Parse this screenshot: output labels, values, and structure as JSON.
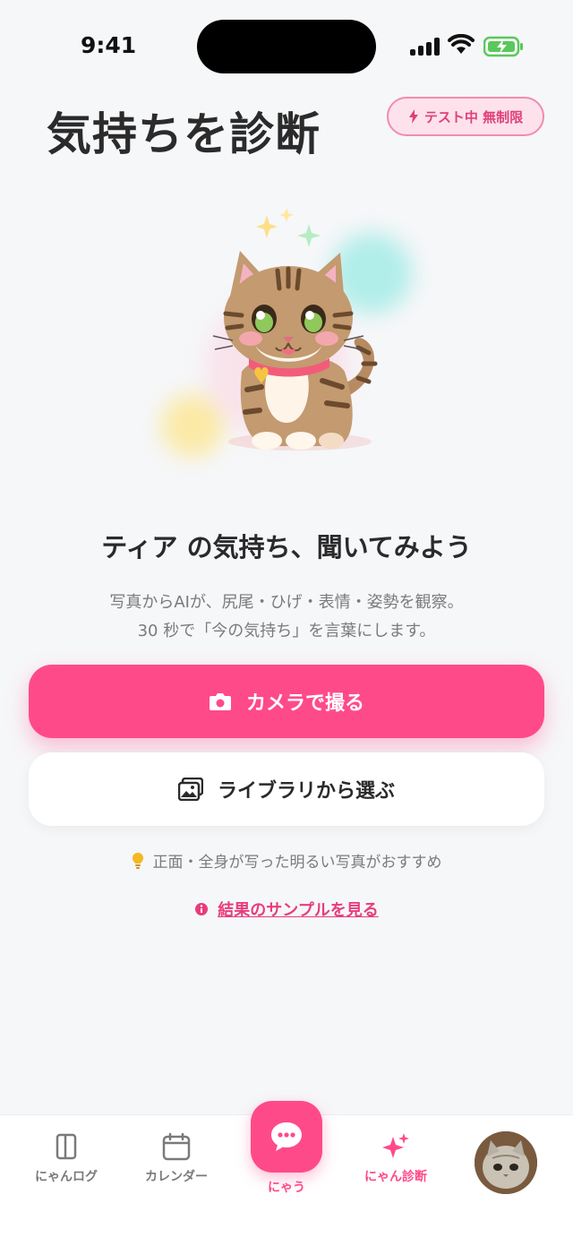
{
  "status_bar": {
    "time": "9:41"
  },
  "header": {
    "title": "気持ちを診断",
    "badge": "テスト中 無制限"
  },
  "main": {
    "headline": "ティア の気持ち、聞いてみよう",
    "description_line1": "写真からAIが、尻尾・ひげ・表情・姿勢を観察。",
    "description_line2": "30 秒で「今の気持ち」を言葉にします。",
    "camera_button": "カメラで撮る",
    "library_button": "ライブラリから選ぶ",
    "tip": "正面・全身が写った明るい写真がおすすめ",
    "sample_link": "結果のサンプルを見る"
  },
  "tab_bar": {
    "items": [
      {
        "label": "にゃんログ",
        "icon": "book-icon"
      },
      {
        "label": "カレンダー",
        "icon": "calendar-icon"
      },
      {
        "label": "にゃう",
        "icon": "chat-bubble-icon"
      },
      {
        "label": "にゃん診断",
        "icon": "sparkles-icon",
        "active": true
      },
      {
        "label": "",
        "icon": "avatar"
      }
    ]
  },
  "colors": {
    "accent": "#ff4a8a",
    "background": "#f6f7f9",
    "badge_bg": "#fde2ec"
  }
}
